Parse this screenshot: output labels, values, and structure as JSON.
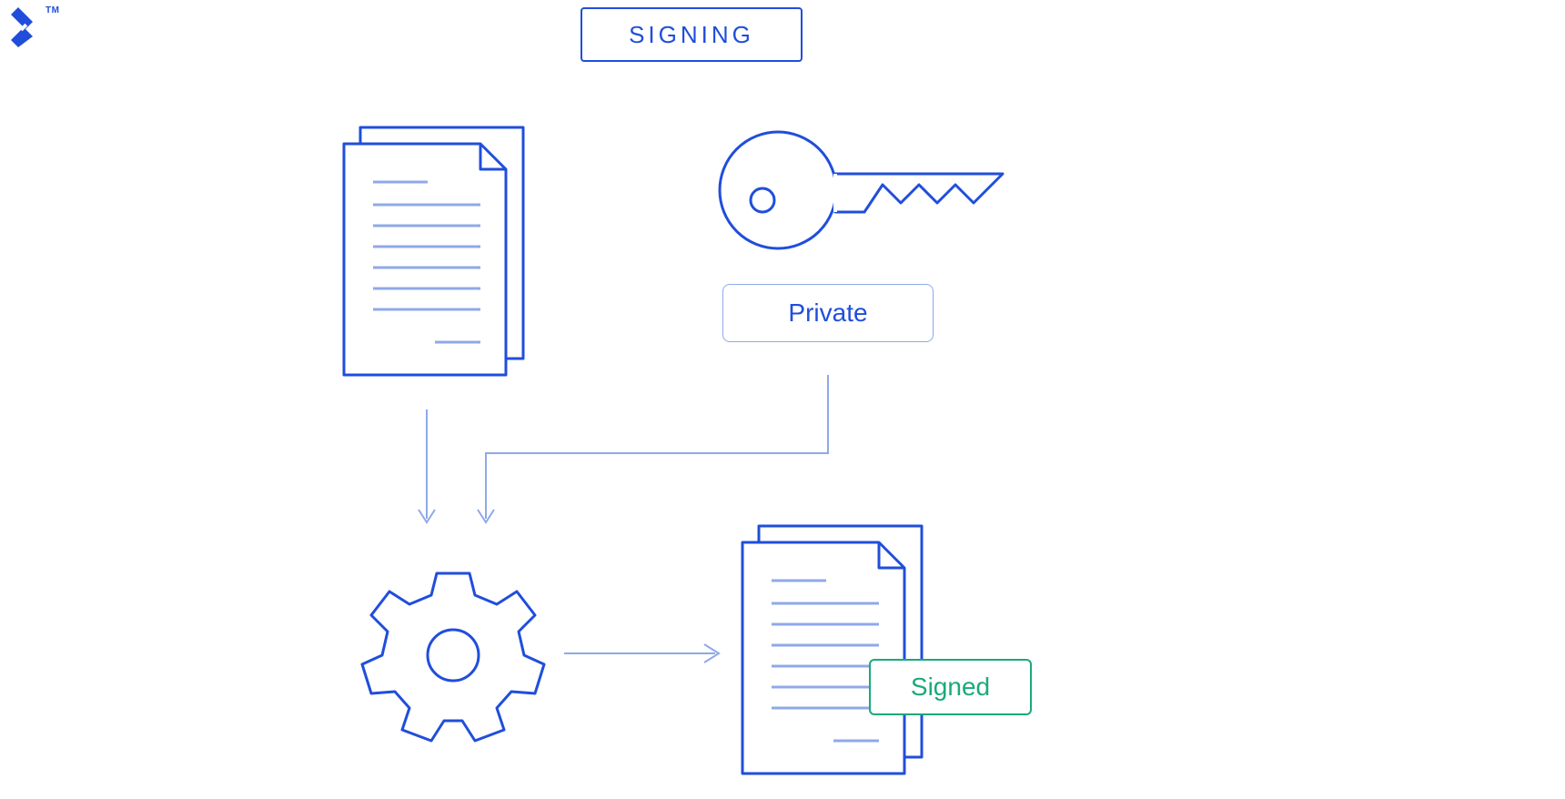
{
  "brand": {
    "trademark": "TM"
  },
  "title": "SIGNING",
  "key_label": "Private",
  "output_label": "Signed",
  "colors": {
    "primary": "#204EDB",
    "primary_light": "#8FA9E8",
    "success": "#1AA97B"
  },
  "nodes": {
    "input_document": "document-stack-icon",
    "private_key": "key-icon",
    "process": "gear-icon",
    "output_document": "document-stack-icon"
  },
  "flow": [
    {
      "from": "input_document",
      "to": "process"
    },
    {
      "from": "private_key",
      "to": "process"
    },
    {
      "from": "process",
      "to": "output_document"
    }
  ]
}
